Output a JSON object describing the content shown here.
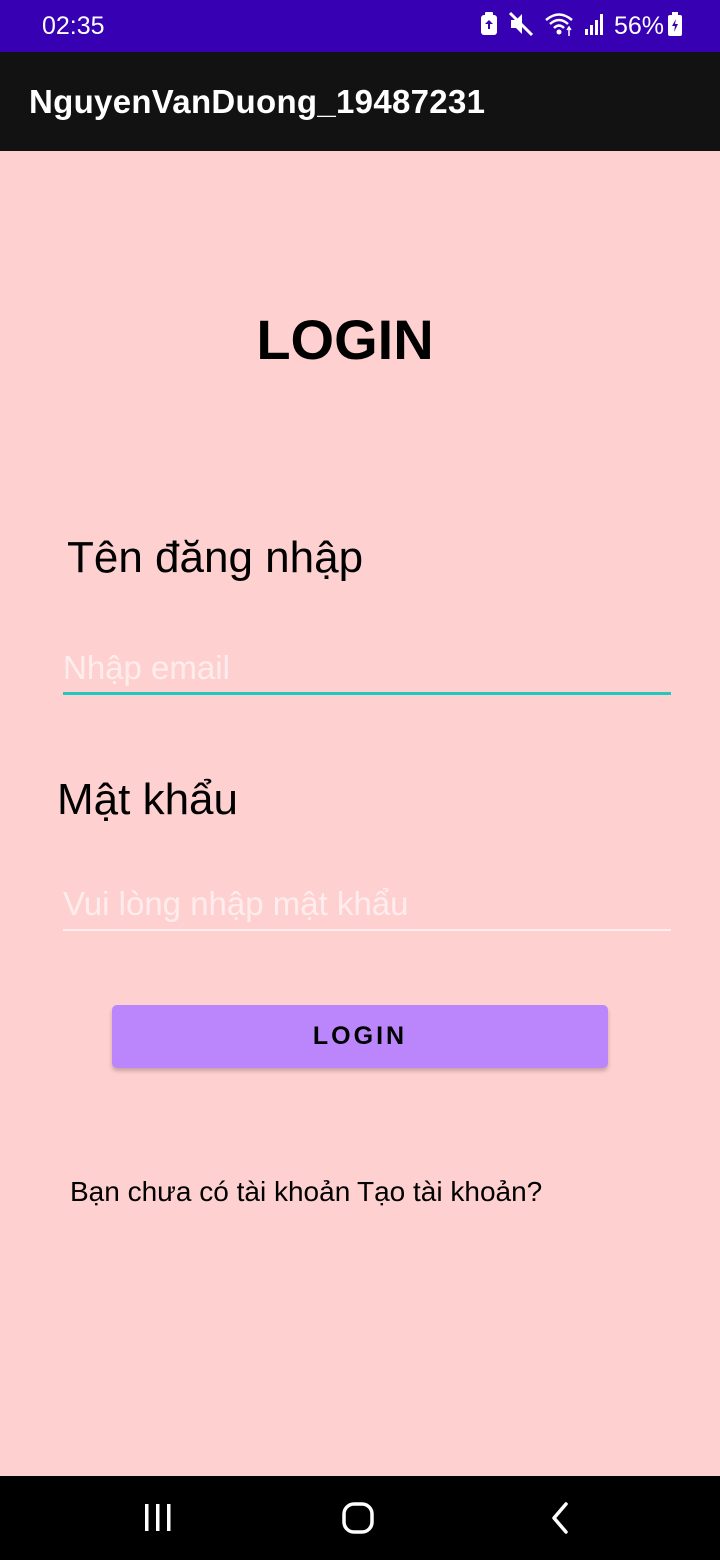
{
  "status_bar": {
    "time": "02:35",
    "battery": "56%",
    "icons": [
      "battery-saver-icon",
      "mute-icon",
      "wifi-icon",
      "signal-icon",
      "battery-charging-icon"
    ]
  },
  "app_bar": {
    "title": "NguyenVanDuong_19487231"
  },
  "login": {
    "title": "LOGIN",
    "username_label": "Tên đăng nhập",
    "email_placeholder": "Nhập email",
    "email_value": "",
    "password_label": "Mật khẩu",
    "password_placeholder": "Vui lòng nhập mật khẩu",
    "password_value": "",
    "login_button": "LOGIN",
    "no_account_text": "Bạn chưa có tài khoản",
    "create_account_link": "Tạo tài khoản?"
  },
  "nav_bar": {
    "icons": [
      "recents-icon",
      "home-icon",
      "back-icon"
    ]
  },
  "colors": {
    "status_bar": "#3700B3",
    "app_bar": "#121212",
    "background": "#FFD0D0",
    "button": "#BB86FC",
    "focused_underline": "#20C9BC",
    "placeholder": "#FFEDED"
  }
}
